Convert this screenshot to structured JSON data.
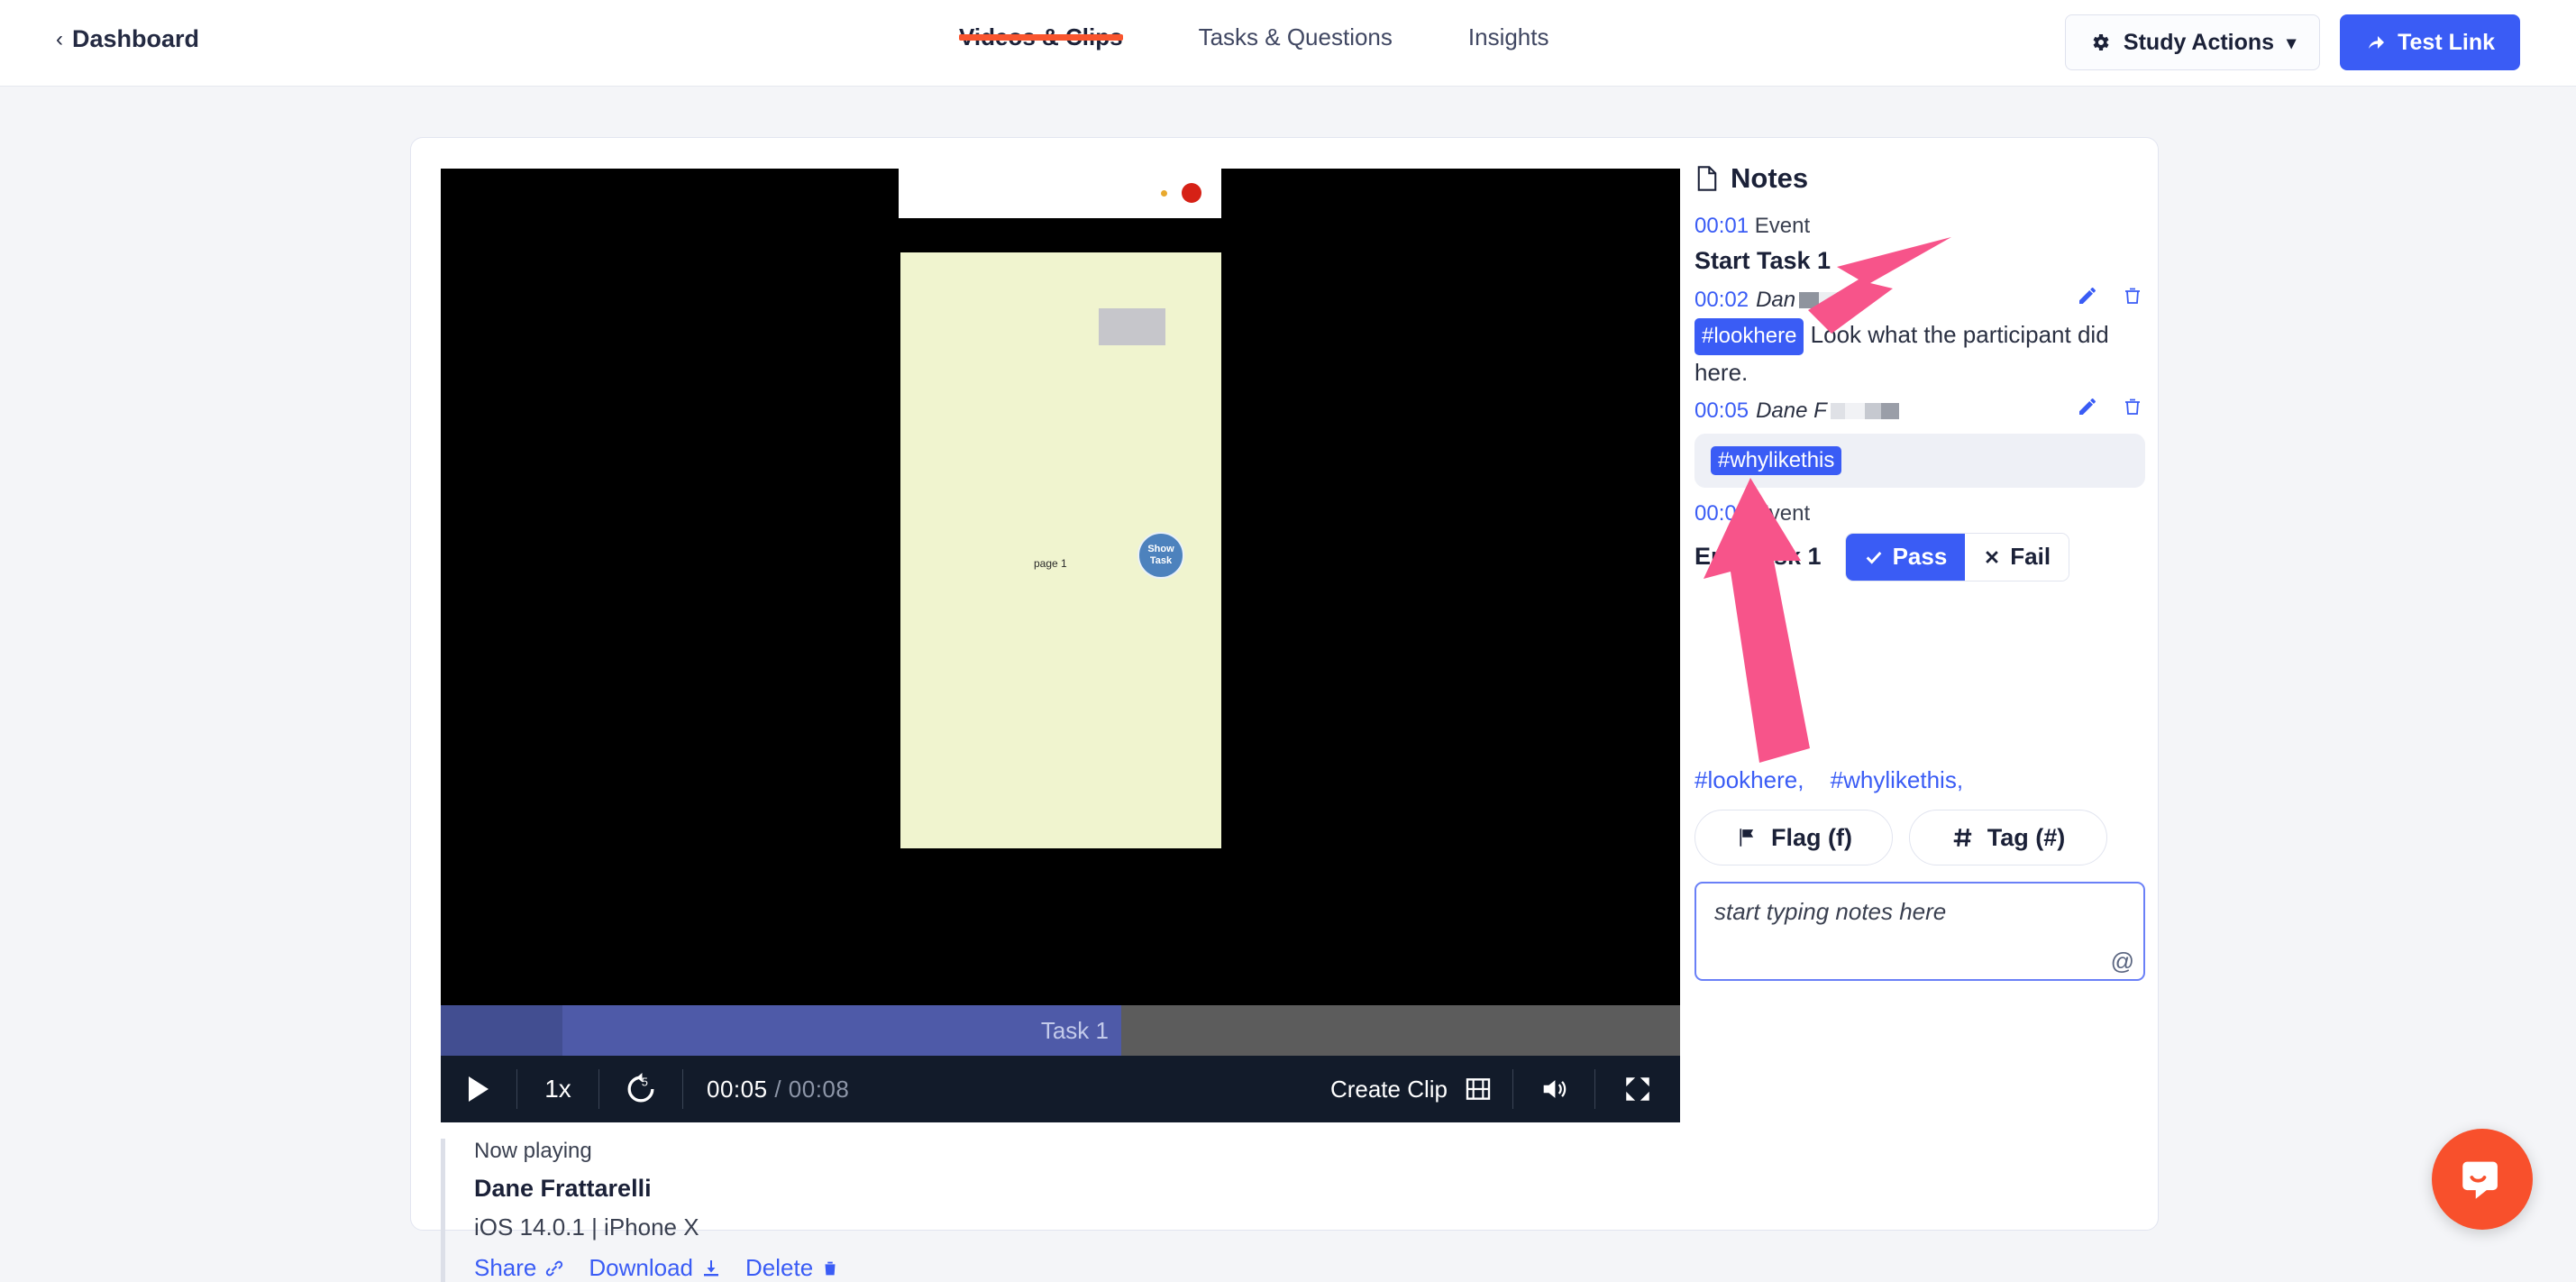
{
  "header": {
    "back_label": "Dashboard",
    "back_icon": "chevron-left-icon",
    "tabs": [
      {
        "label": "Videos & Clips",
        "active": true
      },
      {
        "label": "Tasks & Questions",
        "active": false
      },
      {
        "label": "Insights",
        "active": false
      }
    ],
    "study_actions_label": "Study Actions",
    "study_actions_icon": "gear-icon",
    "study_actions_caret": "⌄",
    "test_link_label": "Test Link",
    "test_link_icon": "share-arrow-icon",
    "accent_color": "#f9552e",
    "primary_color": "#3a5cf5"
  },
  "video": {
    "phone_screen_page_label": "page 1",
    "show_task_line1": "Show",
    "show_task_line2": "Task",
    "timeline_task_label": "Task 1"
  },
  "controls": {
    "play_icon": "play-icon",
    "speed_label": "1x",
    "rewind_label": "5",
    "rewind_icon": "rewind-5-icon",
    "current_time": "00:05",
    "separator": "/",
    "total_time": "00:08",
    "create_clip_label": "Create Clip",
    "create_clip_icon": "film-icon",
    "volume_icon": "volume-icon",
    "fullscreen_icon": "fullscreen-icon"
  },
  "now_playing": {
    "label": "Now playing",
    "participant": "Dane Frattarelli",
    "device": "iOS 14.0.1 | iPhone X",
    "actions": [
      {
        "label": "Share",
        "icon": "link-icon"
      },
      {
        "label": "Download",
        "icon": "download-icon"
      },
      {
        "label": "Delete",
        "icon": "trash-icon"
      }
    ]
  },
  "notes": {
    "title": "Notes",
    "title_icon": "document-icon",
    "items": [
      {
        "timestamp": "00:01",
        "kind": "Event",
        "title": "Start Task 1"
      },
      {
        "timestamp": "00:02",
        "author": "Dan",
        "tag": "#lookhere",
        "body": "Look what the participant did here.",
        "edit_icon": "pencil-icon",
        "delete_icon": "trash-icon"
      },
      {
        "timestamp": "00:05",
        "author": "Dane F",
        "tag": "#whylikethis",
        "body": "",
        "edit_icon": "pencil-icon",
        "delete_icon": "trash-icon"
      },
      {
        "timestamp": "00:08",
        "kind": "Event",
        "title": "End Task 1",
        "pass_label": "Pass",
        "fail_label": "Fail",
        "pass_icon": "check-icon",
        "fail_icon": "x-icon",
        "pass_selected": true
      }
    ],
    "tag_list": [
      "#lookhere,",
      "#whylikethis,"
    ],
    "flag_button": {
      "label": "Flag (f)",
      "icon": "flag-icon"
    },
    "tag_button": {
      "label": "Tag (#)",
      "icon": "hash-icon"
    },
    "input_placeholder": "start typing notes here",
    "input_value": "",
    "mention_icon": "at-icon"
  },
  "intercom": {
    "icon": "chat-bubble-icon",
    "color": "#f8502c"
  }
}
